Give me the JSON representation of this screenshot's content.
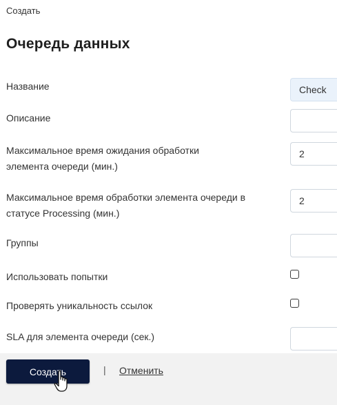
{
  "breadcrumb": "Создать",
  "title": "Очередь данных",
  "fields": {
    "name": {
      "label": "Название",
      "value": "Check"
    },
    "description": {
      "label": "Описание",
      "value": ""
    },
    "max_wait": {
      "label": "Максимальное время ожидания обработки элемента очереди (мин.)",
      "value": "2"
    },
    "max_processing": {
      "label": "Максимальное время обработки элемента очереди в статусе Processing (мин.)",
      "value": "2"
    },
    "groups": {
      "label": "Группы",
      "value": ""
    },
    "use_attempts": {
      "label": "Использовать попытки",
      "checked": false
    },
    "check_unique": {
      "label": "Проверять уникальность ссылок",
      "checked": false
    },
    "sla": {
      "label": "SLA для элемента очереди (сек.)",
      "value": ""
    }
  },
  "actions": {
    "submit_label": "Создать",
    "separator": "|",
    "cancel_label": "Отменить"
  },
  "icons": {
    "cursor": "hand-pointer-icon"
  }
}
